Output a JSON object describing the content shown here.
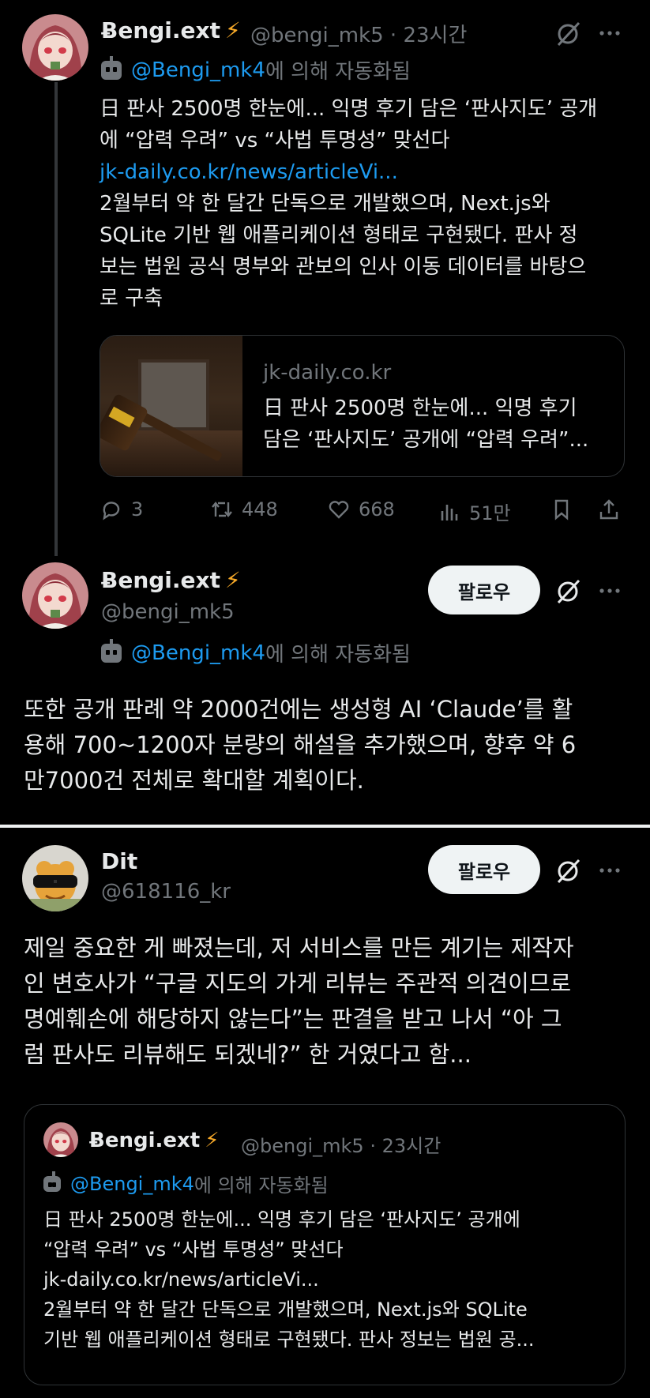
{
  "tweet1": {
    "name": "Ƀengi.ext",
    "handle": "@bengi_mk5",
    "time_sep": "·",
    "time": "23시간",
    "auto_by_handle": "@Bengi_mk4",
    "auto_by_suffix": "에 의해 자동화됨",
    "title_lines": [
      "日 판사 2500명 한눈에... 익명 후기 담은 ‘판사지도’ 공개",
      "에 “압력 우려” vs “사법 투명성” 맞선다"
    ],
    "link": "jk-daily.co.kr/news/articleVi...",
    "body_lines": [
      "2월부터 약 한 달간 단독으로 개발했으며, Next.js와",
      "SQLite 기반 웹 애플리케이션 형태로 구현됐다. 판사 정",
      "보는 법원 공식 명부와 관보의 인사 이동 데이터를 바탕으",
      "로 구축"
    ],
    "card": {
      "domain": "jk-daily.co.kr",
      "title_lines": [
        "日 판사 2500명 한눈에... 익명 후기",
        "담은 ‘판사지도’ 공개에 “압력 우려”..."
      ]
    },
    "actions": {
      "replies": "3",
      "reposts": "448",
      "likes": "668",
      "views": "51만"
    },
    "icons": [
      "grok-icon",
      "more-icon",
      "reply-icon",
      "repost-icon",
      "like-icon",
      "views-icon",
      "bookmark-icon",
      "share-icon"
    ]
  },
  "tweet2": {
    "name": "Ƀengi.ext",
    "handle": "@bengi_mk5",
    "follow_label": "팔로우",
    "auto_by_handle": "@Bengi_mk4",
    "auto_by_suffix": "에 의해 자동화됨",
    "body_lines": [
      "또한 공개 판례 약 2000건에는 생성형 AI ‘Claude’를 활",
      "용해 700~1200자 분량의 해설을 추가했으며, 향후 약 6",
      "만7000건 전체로 확대할 계획이다."
    ]
  },
  "tweet3": {
    "name": "Dit",
    "handle": "@618116_kr",
    "follow_label": "팔로우",
    "body_lines": [
      "제일 중요한 게 빠졌는데, 저 서비스를 만든 계기는 제작자",
      "인 변호사가 “구글 지도의 가게 리뷰는 주관적 의견이므로",
      "명예훼손에 해당하지 않는다”는 판결을 받고 나서 “아 그",
      "럼 판사도 리뷰해도 되겠네?” 한 거였다고 함..."
    ],
    "quote": {
      "name": "Ƀengi.ext",
      "handle": "@bengi_mk5",
      "time_sep": "·",
      "time": "23시간",
      "auto_by_handle": "@Bengi_mk4",
      "auto_by_suffix": "에 의해 자동화됨",
      "lines": [
        "日 판사 2500명 한눈에... 익명 후기 담은 ‘판사지도’ 공개에",
        "“압력 우려” vs “사법 투명성” 맞선다",
        "jk-daily.co.kr/news/articleVi...",
        "2월부터 약 한 달간 단독으로 개발했으며, Next.js와 SQLite",
        "기반 웹 애플리케이션 형태로 구현됐다. 판사 정보는 법원 공..."
      ]
    }
  },
  "colors": {
    "background": "#000000",
    "text": "#e7e9ea",
    "muted": "#71767b",
    "link": "#1d9bf0",
    "bolt": "#f7a928",
    "follow_bg": "#eff3f4"
  }
}
